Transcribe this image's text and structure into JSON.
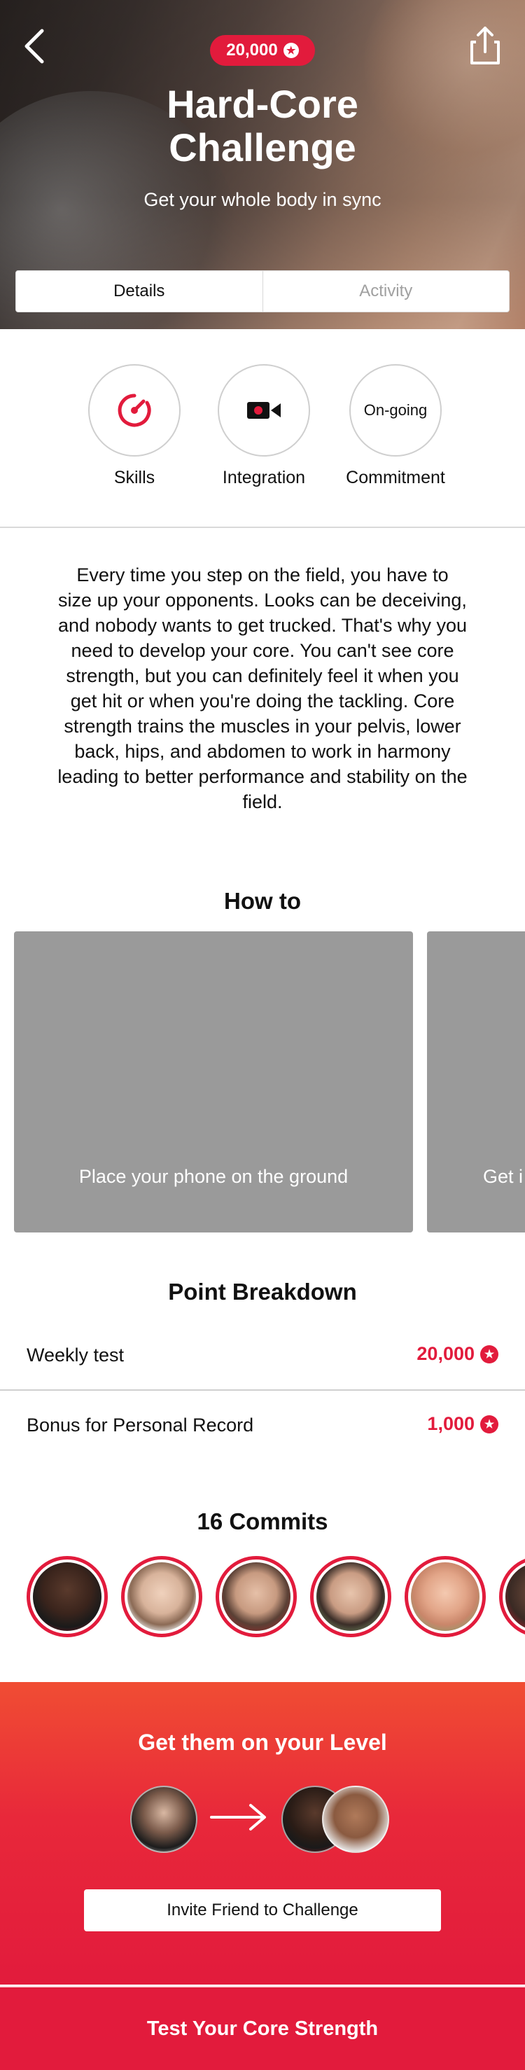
{
  "header": {
    "points": "20,000",
    "title_line1": "Hard-Core",
    "title_line2": "Challenge",
    "subtitle": "Get your whole body in sync",
    "tabs": [
      {
        "label": "Details",
        "active": true
      },
      {
        "label": "Activity",
        "active": false
      }
    ]
  },
  "features": [
    {
      "label": "Skills",
      "icon": "speedometer-icon"
    },
    {
      "label": "Integration",
      "icon": "video-camera-icon"
    },
    {
      "label": "Commitment",
      "circle_text": "On-going"
    }
  ],
  "description": "Every time you step on the field, you have to size up your opponents. Looks can be deceiving, and nobody wants to get trucked. That's why you need to develop your core. You can't see core strength, but you can definitely feel it when you get hit or when you're doing the tackling. Core strength trains the muscles in your pelvis, lower back, hips, and abdomen to work in harmony leading to better performance and stability on the field.",
  "howto": {
    "title": "How to",
    "cards": [
      {
        "caption": "Place your phone on the ground"
      },
      {
        "caption": "Get i"
      }
    ]
  },
  "points": {
    "title": "Point Breakdown",
    "rows": [
      {
        "label": "Weekly test",
        "value": "20,000"
      },
      {
        "label": "Bonus for Personal Record",
        "value": "1,000"
      }
    ]
  },
  "commits": {
    "title": "16 Commits"
  },
  "level": {
    "title": "Get them on your Level",
    "invite_label": "Invite Friend to Challenge"
  },
  "bottom": {
    "cta_label": "Test Your Core Strength"
  },
  "colors": {
    "brand_red": "#e21b3c",
    "gradient_top": "#f04d33",
    "card_gray": "#9a9a9a"
  }
}
